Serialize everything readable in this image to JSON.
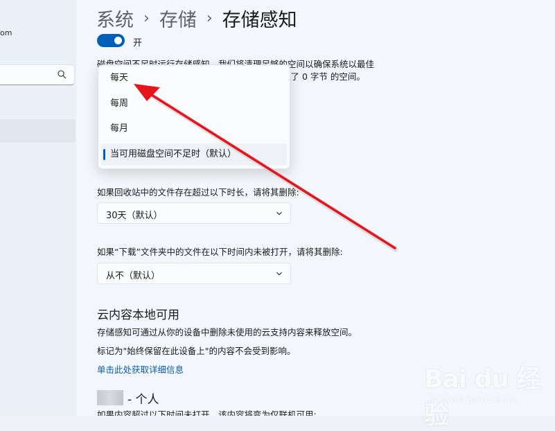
{
  "sidebar": {
    "email_fragment": "om"
  },
  "breadcrumb": {
    "items": [
      "系统",
      "存储",
      "存储感知"
    ]
  },
  "toggle": {
    "label": "开"
  },
  "description": {
    "line1_visible": "磁盘空间不足时运行存储感知。我们将清理足够的空间以确保系统以最佳",
    "line2_visible_fragment": "理了 0 字节 的空间。"
  },
  "dropdown": {
    "options": [
      "每天",
      "每周",
      "每月",
      "当可用磁盘空间不足时（默认）"
    ],
    "selected_index": 3
  },
  "recycle_bin": {
    "label": "如果回收站中的文件存在超过以下时长，请将其删除:",
    "value": "30天（默认）"
  },
  "downloads": {
    "label": "如果“下载”文件夹中的文件在以下时间内未被打开，请将其删除:",
    "value": "从不（默认）"
  },
  "cloud": {
    "title": "云内容本地可用",
    "desc1": "存储感知可通过从你的设备中删除未使用的云支持内容来释放空间。",
    "desc2": "标记为\"始终保留在此设备上\"的内容不会受到影响。",
    "link": "单击此处获取详细信息"
  },
  "personal": {
    "title": "- 个人",
    "desc_partial": "如果内容超过以下时间未打开，该内容将变为仅联机可用:"
  },
  "watermark": {
    "logo": "Bai du 经验",
    "sub": "jingyan.baidu.com"
  },
  "colors": {
    "accent": "#005fb8",
    "annotation_arrow": "#e8141b",
    "link": "#0a5bb0",
    "background": "#f3f6fa"
  }
}
